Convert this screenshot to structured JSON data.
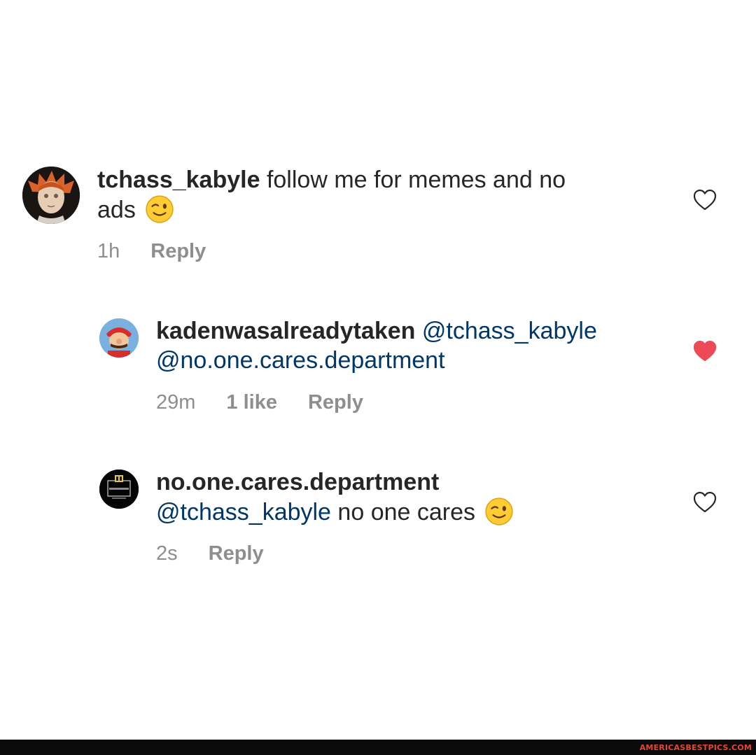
{
  "comments": [
    {
      "username": "tchass_kabyle",
      "text_line1": " follow me for memes and no",
      "text_line2": "ads",
      "emoji": "winking-face",
      "time": "1h",
      "reply_label": "Reply",
      "liked": false
    },
    {
      "username": "kadenwasalreadytaken",
      "mention1": "@tchass_kabyle",
      "mention2": "@no.one.cares.department",
      "time": "29m",
      "likes": "1 like",
      "reply_label": "Reply",
      "liked": true
    },
    {
      "username": "no.one.cares.department",
      "mention": "@tchass_kabyle",
      "text": " no one cares",
      "emoji": "winking-face",
      "time": "2s",
      "reply_label": "Reply",
      "liked": false
    }
  ],
  "colors": {
    "text": "#262626",
    "mention": "#00376b",
    "meta": "#8e8e8e",
    "liked_heart": "#ed4956"
  },
  "watermark": "AMERICASBESTPICS.COM"
}
